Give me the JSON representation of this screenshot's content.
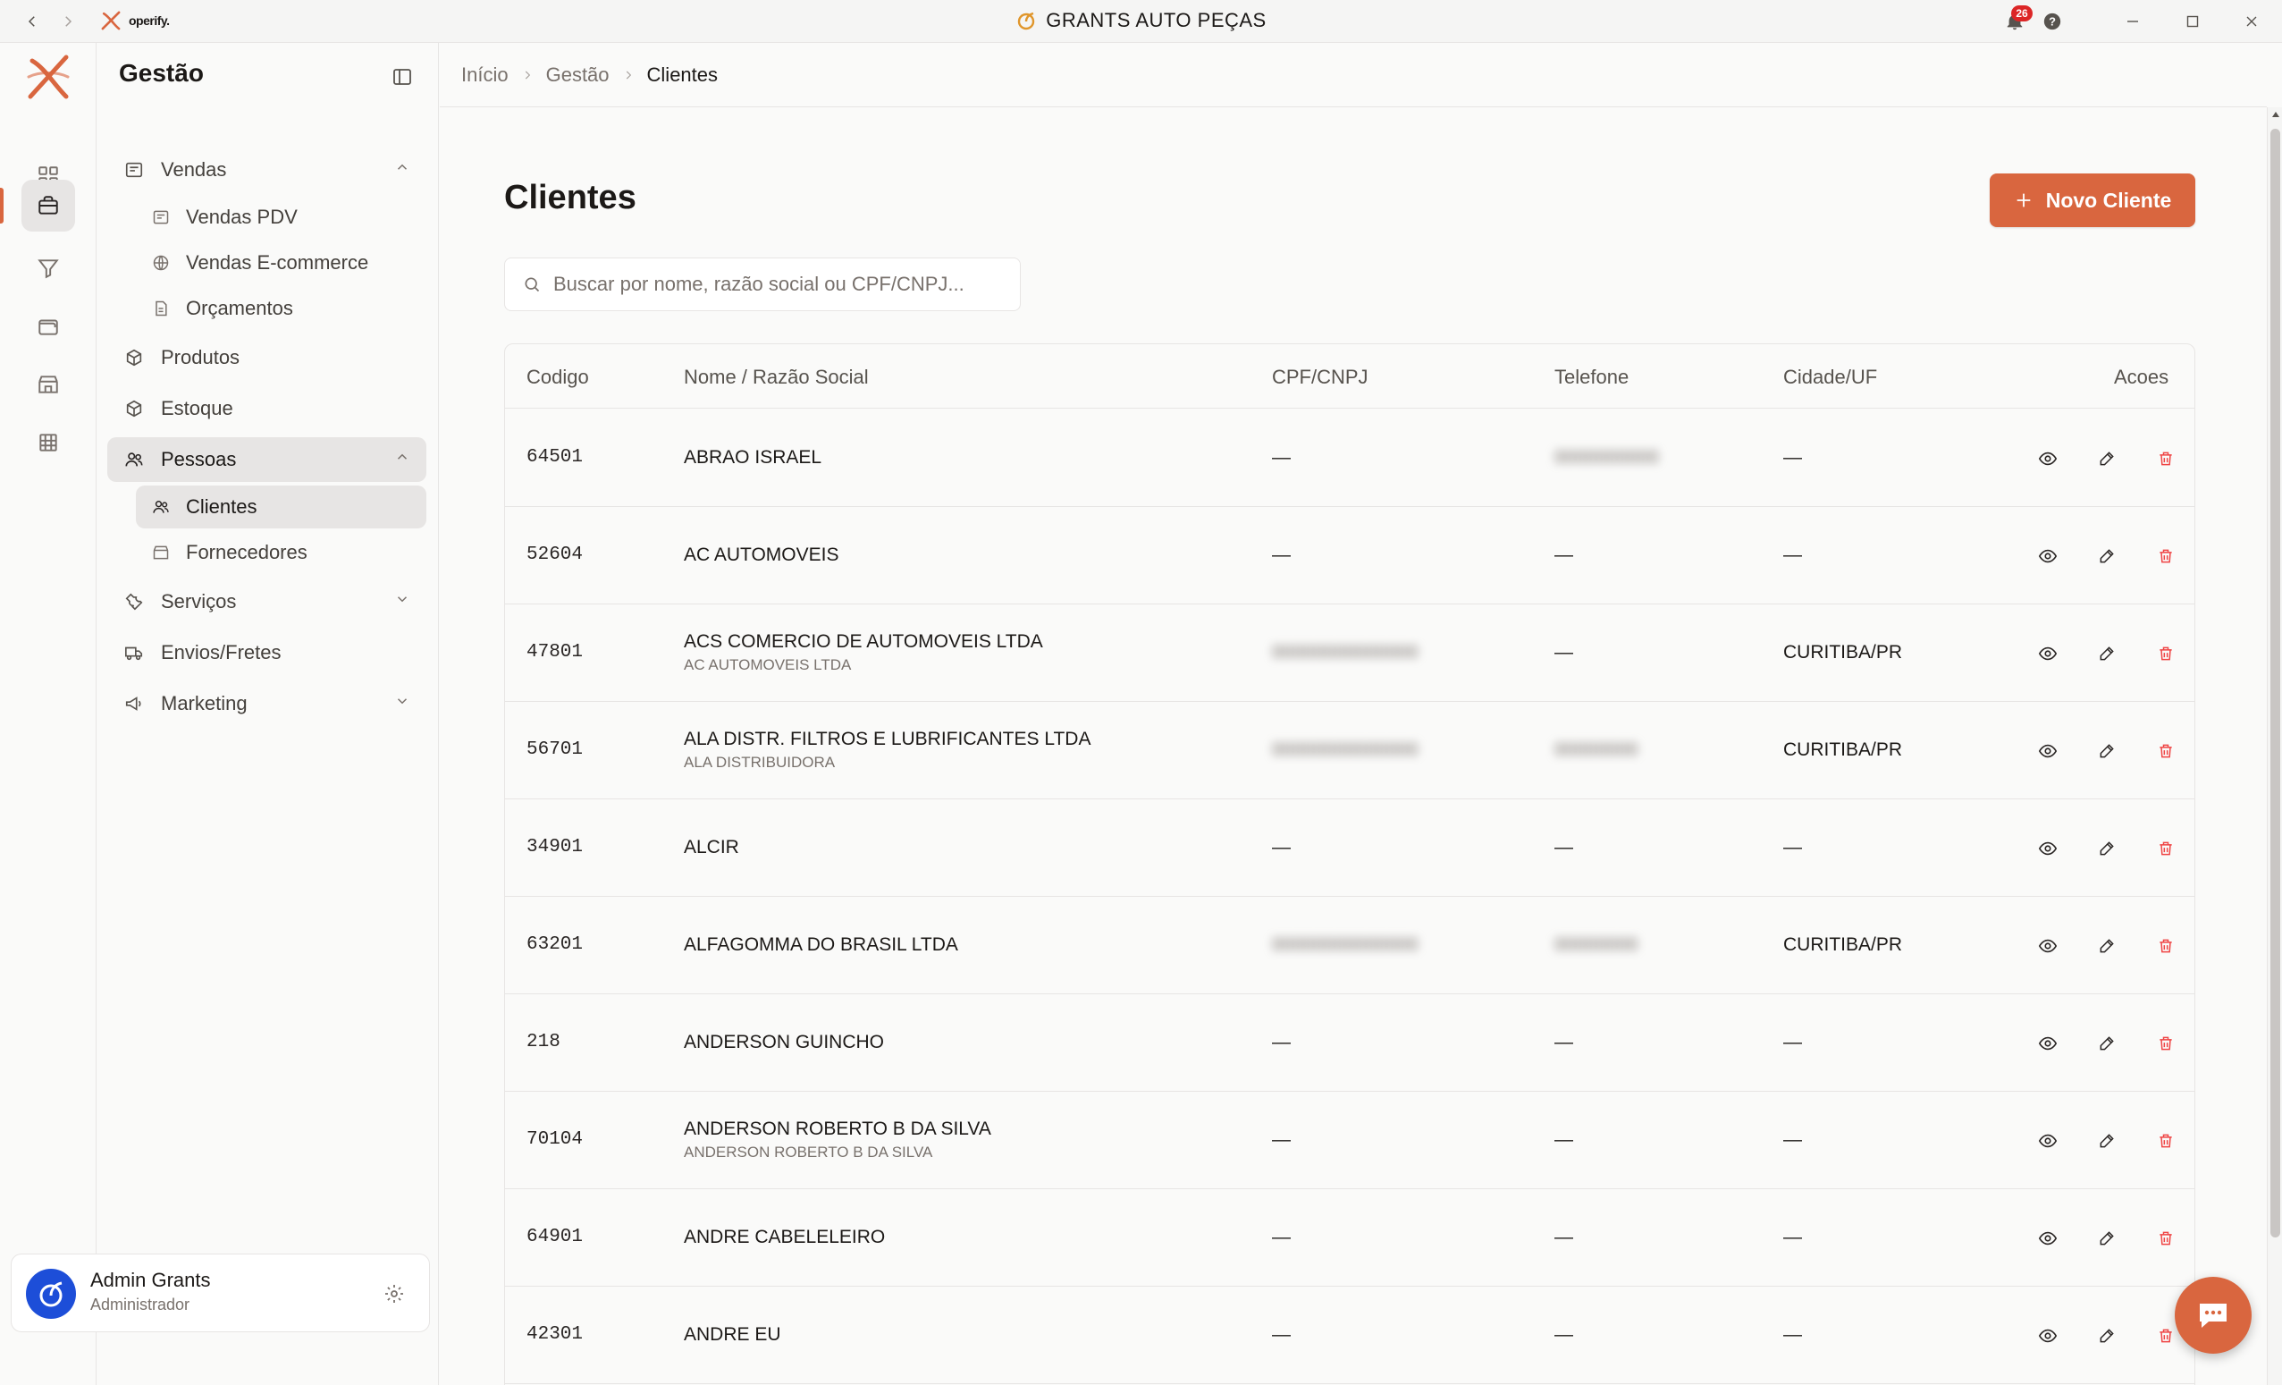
{
  "titlebar": {
    "app_logo_text": "operify.",
    "title": "GRANTS AUTO PEÇAS",
    "notification_count": "26"
  },
  "sidebar": {
    "title": "Gestão",
    "items": [
      {
        "label": "Vendas",
        "icon": "receipt-icon",
        "expanded": true,
        "children": [
          {
            "label": "Vendas PDV",
            "icon": "receipt-icon"
          },
          {
            "label": "Vendas E-commerce",
            "icon": "globe-icon"
          },
          {
            "label": "Orçamentos",
            "icon": "file-icon"
          }
        ]
      },
      {
        "label": "Produtos",
        "icon": "package-icon"
      },
      {
        "label": "Estoque",
        "icon": "package-icon"
      },
      {
        "label": "Pessoas",
        "icon": "users-icon",
        "expanded": true,
        "active": true,
        "children": [
          {
            "label": "Clientes",
            "icon": "users-icon",
            "active": true
          },
          {
            "label": "Fornecedores",
            "icon": "store-icon"
          }
        ]
      },
      {
        "label": "Serviços",
        "icon": "wrench-icon",
        "expanded": false
      },
      {
        "label": "Envios/Fretes",
        "icon": "truck-icon"
      },
      {
        "label": "Marketing",
        "icon": "megaphone-icon",
        "expanded": false
      }
    ],
    "user": {
      "name": "Admin Grants",
      "role": "Administrador"
    }
  },
  "breadcrumb": [
    "Início",
    "Gestão",
    "Clientes"
  ],
  "page": {
    "title": "Clientes",
    "new_button": "Novo Cliente",
    "search_placeholder": "Buscar por nome, razão social ou CPF/CNPJ..."
  },
  "table": {
    "columns": [
      "Codigo",
      "Nome / Razão Social",
      "CPF/CNPJ",
      "Telefone",
      "Cidade/UF",
      "Acoes"
    ],
    "rows": [
      {
        "code": "64501",
        "name": "ABRAO ISRAEL",
        "fantasia": "",
        "doc": "—",
        "tel": "0000000000",
        "tel_blurred": true,
        "city": "—"
      },
      {
        "code": "52604",
        "name": "AC AUTOMOVEIS",
        "fantasia": "",
        "doc": "—",
        "tel": "—",
        "city": "—"
      },
      {
        "code": "47801",
        "name": "ACS COMERCIO DE AUTOMOVEIS LTDA",
        "fantasia": "AC AUTOMOVEIS LTDA",
        "doc": "00000000000000",
        "doc_blurred": true,
        "tel": "—",
        "city": "CURITIBA/PR"
      },
      {
        "code": "56701",
        "name": "ALA DISTR. FILTROS E LUBRIFICANTES LTDA",
        "fantasia": "ALA DISTRIBUIDORA",
        "doc": "00000000000000",
        "doc_blurred": true,
        "tel": "00000000",
        "tel_blurred": true,
        "city": "CURITIBA/PR"
      },
      {
        "code": "34901",
        "name": "ALCIR",
        "fantasia": "",
        "doc": "—",
        "tel": "—",
        "city": "—"
      },
      {
        "code": "63201",
        "name": "ALFAGOMMA DO BRASIL LTDA",
        "fantasia": "",
        "doc": "00000000000000",
        "doc_blurred": true,
        "tel": "00000000",
        "tel_blurred": true,
        "city": "CURITIBA/PR"
      },
      {
        "code": "218",
        "name": "ANDERSON GUINCHO",
        "fantasia": "",
        "doc": "—",
        "tel": "—",
        "city": "—"
      },
      {
        "code": "70104",
        "name": "ANDERSON ROBERTO B DA SILVA",
        "fantasia": "ANDERSON ROBERTO B DA SILVA",
        "doc": "—",
        "tel": "—",
        "city": "—"
      },
      {
        "code": "64901",
        "name": "ANDRE CABELELEIRO",
        "fantasia": "",
        "doc": "—",
        "tel": "—",
        "city": "—"
      },
      {
        "code": "42301",
        "name": "ANDRE EU",
        "fantasia": "",
        "doc": "—",
        "tel": "—",
        "city": "—"
      }
    ]
  },
  "colors": {
    "accent": "#d9663f",
    "danger": "#ef4444",
    "border": "#e7e5e4",
    "surface": "#fafaf9"
  }
}
